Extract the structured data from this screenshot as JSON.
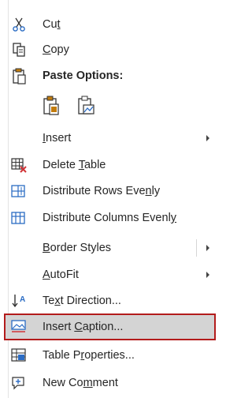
{
  "menu": {
    "items": {
      "cut": {
        "pre": "Cu",
        "acc": "t",
        "post": ""
      },
      "copy": {
        "pre": "",
        "acc": "C",
        "post": "opy"
      },
      "paste_options": {
        "label": "Paste Options:"
      },
      "insert": {
        "pre": "",
        "acc": "I",
        "post": "nsert"
      },
      "delete_table": {
        "pre": "Delete ",
        "acc": "T",
        "post": "able"
      },
      "distribute_rows": {
        "pre": "Distribute Rows Eve",
        "acc": "n",
        "post": "ly"
      },
      "distribute_columns": {
        "pre": "Distribute Columns Evenl",
        "acc": "y",
        "post": ""
      },
      "border_styles": {
        "pre": "",
        "acc": "B",
        "post": "order Styles"
      },
      "autofit": {
        "pre": "",
        "acc": "A",
        "post": "utoFit"
      },
      "text_direction": {
        "pre": "Te",
        "acc": "x",
        "post": "t Direction..."
      },
      "insert_caption": {
        "pre": "Insert ",
        "acc": "C",
        "post": "aption..."
      },
      "table_properties": {
        "pre": "Table P",
        "acc": "r",
        "post": "operties..."
      },
      "new_comment": {
        "pre": "New Co",
        "acc": "m",
        "post": "ment"
      }
    },
    "icons": {
      "cut": "scissors-icon",
      "copy": "copy-icon",
      "paste": "paste-icon",
      "paste_keep": "paste-keep-formatting-icon",
      "paste_picture": "paste-picture-icon",
      "delete_table": "delete-table-icon",
      "distribute_rows": "distribute-rows-icon",
      "distribute_columns": "distribute-columns-icon",
      "text_direction": "text-direction-icon",
      "insert_caption": "insert-caption-icon",
      "table_properties": "table-properties-icon",
      "new_comment": "new-comment-icon"
    },
    "colors": {
      "highlight_border": "#b31b1b",
      "highlight_fill": "#d4d4d4",
      "icon_blue": "#2b6cc4",
      "icon_red": "#d13438",
      "icon_orange": "#c27c0e"
    }
  }
}
